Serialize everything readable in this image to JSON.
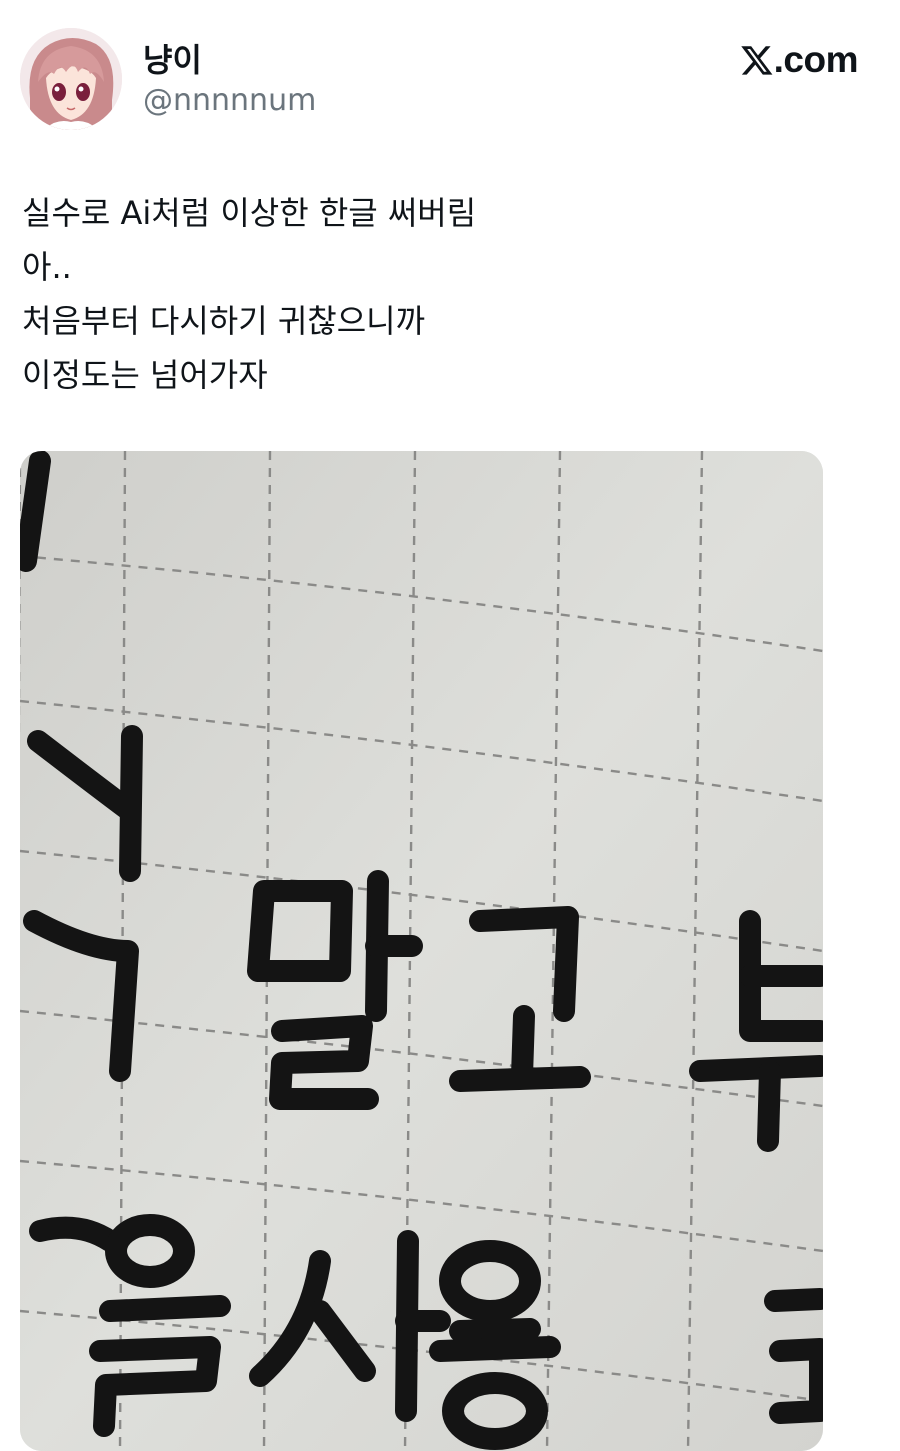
{
  "author": {
    "display_name": "냥이",
    "handle": "@nnnnnum",
    "avatar_icon": "anime-avatar-icon"
  },
  "site": {
    "logo_icon": "x-logo-icon",
    "label": ".com"
  },
  "tweet": {
    "lines": [
      "실수로 Ai처럼 이상한 한글 써버림",
      "아..",
      "처음부터 다시하기 귀찮으니까",
      "이정도는 넘어가자"
    ]
  },
  "media": {
    "handwriting_row1": [
      "말",
      "고",
      "부"
    ],
    "handwriting_row2": [
      "을",
      "사용"
    ],
    "handwriting_partial": [
      "지",
      "다"
    ],
    "ink_color": "#141414",
    "paper_color": "#dcdcd8",
    "grid_color": "#8a8a88"
  },
  "colors": {
    "text_primary": "#0f1419",
    "text_secondary": "#6b757d",
    "background": "#ffffff"
  }
}
